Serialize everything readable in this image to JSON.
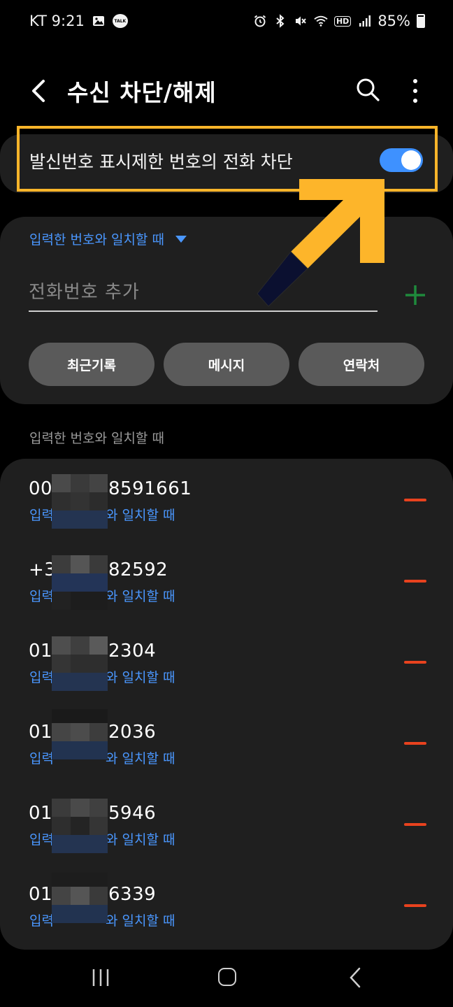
{
  "status_bar": {
    "carrier_time": "KT 9:21",
    "talk_badge": "TALK",
    "hd": "HD",
    "battery": "85%",
    "icons": [
      "gallery-icon",
      "talk-icon",
      "alarm-icon",
      "bluetooth-icon",
      "mute-icon",
      "wifi-icon",
      "hd-icon",
      "signal-icon",
      "battery-icon"
    ]
  },
  "app_bar": {
    "title": "수신 차단/해제",
    "back_icon": "chevron-left-icon",
    "search_icon": "search-icon",
    "more_icon": "more-vertical-icon"
  },
  "caller_id_block": {
    "label": "발신번호 표시제한 번호의 전화 차단",
    "enabled": true
  },
  "add_number": {
    "match_mode": "입력한 번호와 일치할 때",
    "input_placeholder": "전화번호 추가",
    "input_value": "",
    "add_icon": "plus-icon",
    "chips": [
      "최근기록",
      "메시지",
      "연락처"
    ]
  },
  "blocked_list": {
    "header": "입력한 번호와 일치할 때",
    "items": [
      {
        "prefix": "00",
        "suffix": "8591661",
        "sub_prefix": "입력",
        "sub_suffix": "와 일치할 때"
      },
      {
        "prefix": "+3",
        "suffix": "82592",
        "sub_prefix": "입력",
        "sub_suffix": "와 일치할 때"
      },
      {
        "prefix": "01",
        "suffix": "2304",
        "sub_prefix": "입력",
        "sub_suffix": "와 일치할 때"
      },
      {
        "prefix": "01",
        "suffix": "2036",
        "sub_prefix": "입력",
        "sub_suffix": "와 일치할 때"
      },
      {
        "prefix": "01",
        "suffix": "5946",
        "sub_prefix": "입력",
        "sub_suffix": "와 일치할 때"
      },
      {
        "prefix": "01",
        "suffix": "6339",
        "sub_prefix": "입력",
        "sub_suffix": "와 일치할 때"
      }
    ]
  },
  "colors": {
    "accent_blue": "#4a97ff",
    "toggle_on": "#3e91ff",
    "remove_red": "#e8421e",
    "highlight": "#fdb52a",
    "add_green": "#1f8a3c"
  }
}
